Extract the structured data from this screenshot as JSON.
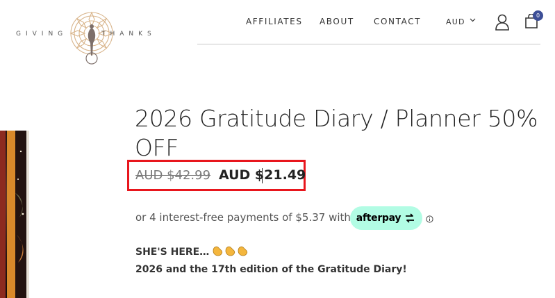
{
  "brand": {
    "word_left": "GIVING",
    "word_right": "THANKS",
    "accent_color": "#d8b48a"
  },
  "nav": {
    "items": [
      "AFFILIATES",
      "ABOUT",
      "CONTACT"
    ],
    "currency": "AUD",
    "cart_count": "0"
  },
  "product": {
    "title": "2026 Gratitude Diary / Planner 50% OFF",
    "price_original": "AUD $42.99",
    "price_sale": "AUD $21.49",
    "installments_text": "or 4 interest-free payments of $5.37 with",
    "afterpay_label": "afterpay",
    "description_line1": "SHE'S HERE…",
    "description_line2": "2026 and the 17th edition of the Gratitude Diary!"
  },
  "colors": {
    "highlight_border": "#e8161d",
    "afterpay_mint": "#b2fce4",
    "cart_badge": "#3d4f97"
  },
  "icons": [
    "logo-mandala-icon",
    "chevron-down-icon",
    "user-icon",
    "cart-icon",
    "afterpay-arrows-icon",
    "info-icon",
    "clapping-hands-icon"
  ]
}
